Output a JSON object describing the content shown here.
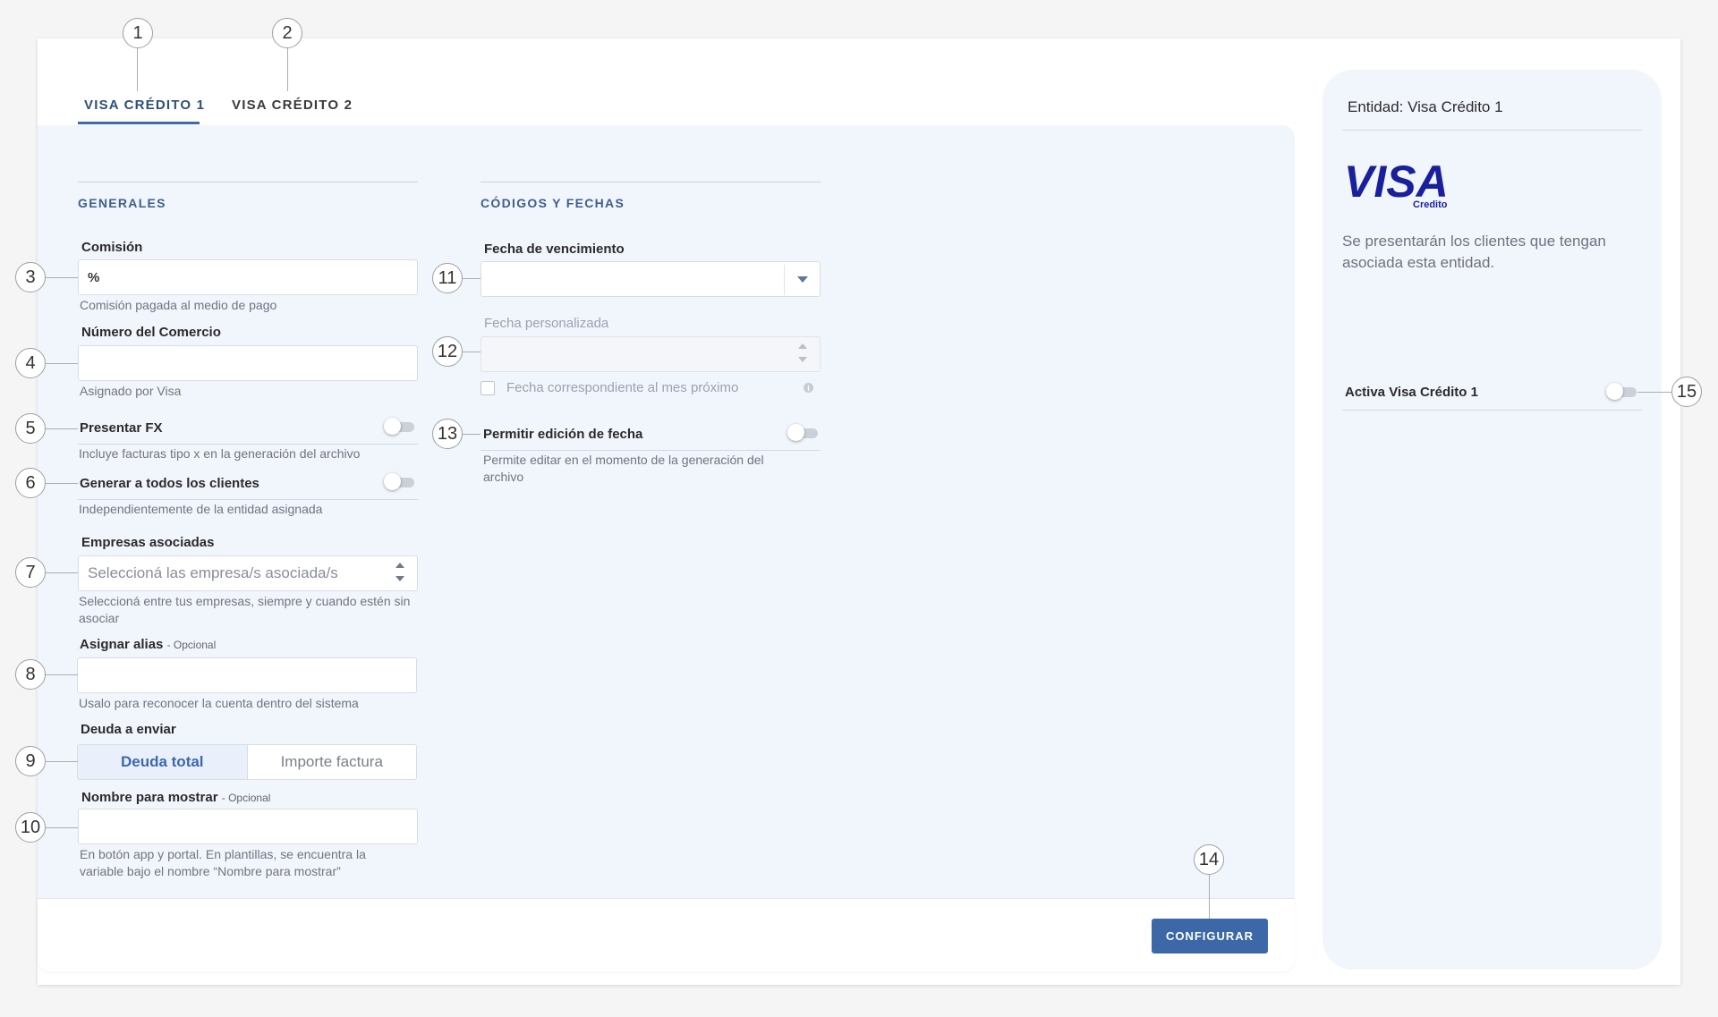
{
  "tabs": [
    {
      "label": "VISA CRÉDITO 1"
    },
    {
      "label": "VISA CRÉDITO 2"
    }
  ],
  "sections": {
    "generales": "GENERALES",
    "codigos": "CÓDIGOS Y FECHAS"
  },
  "fields": {
    "comision": {
      "label": "Comisión",
      "prefix": "%",
      "help": "Comisión pagada al medio de pago"
    },
    "numero_comercio": {
      "label": "Número del Comercio",
      "help": "Asignado por Visa"
    },
    "presentar_fx": {
      "label": "Presentar FX",
      "help": "Incluye facturas tipo x en la generación del archivo"
    },
    "generar_todos": {
      "label": "Generar a todos los clientes",
      "help": "Independientemente de la entidad asignada"
    },
    "empresas": {
      "label": "Empresas asociadas",
      "placeholder": "Seleccioná las empresa/s asociada/s",
      "help": "Seleccioná entre tus empresas, siempre y cuando estén sin asociar"
    },
    "alias": {
      "label": "Asignar alias",
      "optional": "- Opcional",
      "help": "Usalo para reconocer la cuenta dentro del sistema"
    },
    "deuda": {
      "label": "Deuda a enviar",
      "options": [
        "Deuda total",
        "Importe factura"
      ],
      "selected": "Deuda total"
    },
    "nombre_mostrar": {
      "label": "Nombre para mostrar",
      "optional": "- Opcional",
      "help": "En botón app y portal. En plantillas, se encuentra la variable bajo el nombre “Nombre para mostrar”"
    },
    "fecha_vencimiento": {
      "label": "Fecha de vencimiento"
    },
    "fecha_personalizada": {
      "label": "Fecha personalizada"
    },
    "fecha_mes_proximo": {
      "label": "Fecha correspondiente al mes próximo"
    },
    "permitir_edicion": {
      "label": "Permitir edición de fecha",
      "help": "Permite editar en el momento de la generación del archivo"
    }
  },
  "footer": {
    "configurar_label": "CONFIGURAR"
  },
  "side": {
    "title": "Entidad: Visa Crédito 1",
    "logo_text": "VISA",
    "logo_sub": "Credito",
    "description": "Se presentarán los clientes que tengan asociada esta entidad.",
    "toggle_label": "Activa Visa Crédito 1"
  },
  "callouts": [
    "1",
    "2",
    "3",
    "4",
    "5",
    "6",
    "7",
    "8",
    "9",
    "10",
    "11",
    "12",
    "13",
    "14",
    "15"
  ],
  "colors": {
    "accent": "#3d68a8",
    "panel": "#f1f5fc",
    "visa_blue": "#1a1f9c"
  }
}
